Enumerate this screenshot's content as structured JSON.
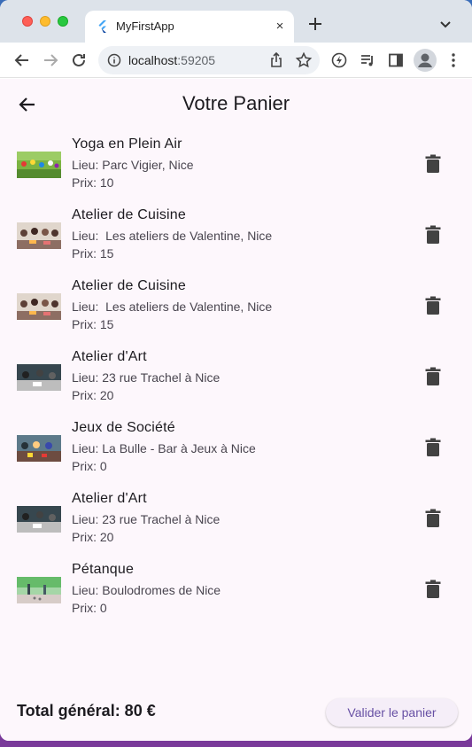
{
  "browser": {
    "tab_title": "MyFirstApp",
    "tab_close": "×",
    "url_host": "localhost",
    "url_port": ":59205"
  },
  "icons": {
    "back": "arrow-left-icon",
    "forward": "arrow-right-icon",
    "reload": "reload-icon",
    "info": "info-icon",
    "share": "share-icon",
    "bookmark": "star-icon",
    "extension": "lightning-icon",
    "media": "playlist-icon",
    "sidepanel": "sidepanel-icon",
    "profile": "person-icon",
    "menu": "kebab-icon",
    "trash": "trash-icon"
  },
  "colors": {
    "primary": "#6750a4",
    "app_bg": "#fdf7fc",
    "text": "#1d1b20",
    "subtext": "#49454f",
    "icon": "#424242"
  },
  "app": {
    "title": "Votre Panier"
  },
  "cart": {
    "items": [
      {
        "title": "Yoga en Plein Air",
        "lieu": "Lieu: Parc Vigier, Nice",
        "prix": "Prix: 10",
        "thumb": "yoga"
      },
      {
        "title": "Atelier de Cuisine",
        "lieu": "Lieu:  Les ateliers de Valentine, Nice",
        "prix": "Prix: 15",
        "thumb": "cuisine"
      },
      {
        "title": "Atelier de Cuisine",
        "lieu": "Lieu:  Les ateliers de Valentine, Nice",
        "prix": "Prix: 15",
        "thumb": "cuisine"
      },
      {
        "title": "Atelier d'Art",
        "lieu": "Lieu: 23 rue Trachel à Nice",
        "prix": "Prix: 20",
        "thumb": "art"
      },
      {
        "title": "Jeux de Société",
        "lieu": "Lieu: La Bulle - Bar à Jeux à Nice",
        "prix": "Prix: 0",
        "thumb": "jeux"
      },
      {
        "title": "Atelier d'Art",
        "lieu": "Lieu: 23 rue Trachel à Nice",
        "prix": "Prix: 20",
        "thumb": "art"
      },
      {
        "title": "Pétanque",
        "lieu": "Lieu: Boulodromes de Nice",
        "prix": "Prix: 0",
        "thumb": "petanque"
      }
    ]
  },
  "footer": {
    "total": "Total général: 80 €",
    "validate_label": "Valider le panier"
  }
}
